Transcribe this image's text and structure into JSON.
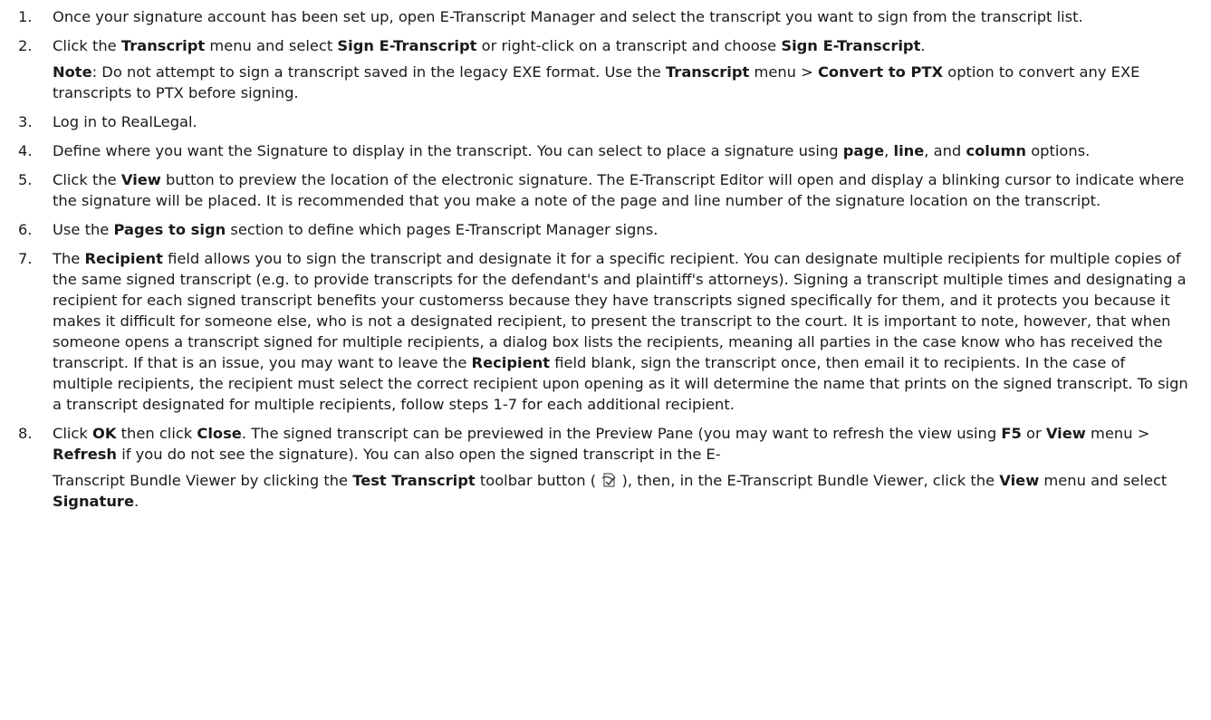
{
  "steps": [
    {
      "num": "1.",
      "parts": [
        {
          "t": "Once your signature account has been set up, open E-Transcript Manager and select the transcript you want to sign from the transcript list."
        }
      ]
    },
    {
      "num": "2.",
      "parts": [
        {
          "t": "Click the "
        },
        {
          "t": "Transcript",
          "b": true
        },
        {
          "t": " menu and select "
        },
        {
          "t": "Sign E-Transcript",
          "b": true
        },
        {
          "t": " or right-click on a transcript and choose "
        },
        {
          "t": "Sign E-Transcript",
          "b": true
        },
        {
          "t": "."
        }
      ],
      "note": [
        {
          "t": "Note",
          "b": true
        },
        {
          "t": ": Do not attempt to sign a transcript saved in the legacy EXE format. Use the "
        },
        {
          "t": "Transcript",
          "b": true
        },
        {
          "t": " menu > "
        },
        {
          "t": "Convert to PTX",
          "b": true
        },
        {
          "t": " option to convert any EXE transcripts to PTX before signing."
        }
      ]
    },
    {
      "num": "3.",
      "parts": [
        {
          "t": "Log in to RealLegal."
        }
      ]
    },
    {
      "num": "4.",
      "parts": [
        {
          "t": "Define where you want the Signature to display in the transcript. You can select to place a signature using "
        },
        {
          "t": "page",
          "b": true
        },
        {
          "t": ", "
        },
        {
          "t": "line",
          "b": true
        },
        {
          "t": ", and "
        },
        {
          "t": "column",
          "b": true
        },
        {
          "t": " options."
        }
      ]
    },
    {
      "num": "5.",
      "parts": [
        {
          "t": "Click the "
        },
        {
          "t": "View",
          "b": true
        },
        {
          "t": " button to preview the location of the electronic signature. The E-Transcript Editor will open and display a blinking cursor to indicate where the signature will be placed. It is recommended that you make a note of the page and line number of the signature location on the transcript."
        }
      ]
    },
    {
      "num": "6.",
      "parts": [
        {
          "t": "Use the "
        },
        {
          "t": "Pages to sign",
          "b": true
        },
        {
          "t": " section to define which pages E-Transcript Manager signs."
        }
      ]
    },
    {
      "num": "7.",
      "parts": [
        {
          "t": "The "
        },
        {
          "t": "Recipient",
          "b": true
        },
        {
          "t": " field allows you to sign the transcript and designate it for a specific recipient. You can designate multiple recipients for multiple copies of the same signed transcript (e.g. to provide transcripts for the defendant's and plaintiff's attorneys). Signing a transcript multiple times and designating a recipient for each signed transcript benefits your customerss because they have transcripts signed specifically for them, and it protects you because it makes it difficult for someone else, who is not a designated recipient, to present the transcript to the court. It is important to note, however, that when someone opens a transcript signed for multiple recipients, a dialog box lists the recipients, meaning all parties in the case know who has received the transcript. If that is an issue, you may want to leave the "
        },
        {
          "t": "Recipient",
          "b": true
        },
        {
          "t": " field blank, sign the transcript once, then email it to recipients. In the case of multiple recipients, the recipient must select the correct recipient upon opening as it will determine the name that prints on the signed transcript. To sign a transcript designated for multiple recipients, follow steps 1-7 for each additional recipient."
        }
      ]
    },
    {
      "num": "8.",
      "parts": [
        {
          "t": "Click "
        },
        {
          "t": "OK",
          "b": true
        },
        {
          "t": " then click "
        },
        {
          "t": "Close",
          "b": true
        },
        {
          "t": ". The signed transcript can be previewed in the Preview Pane (you may want to refresh the view using "
        },
        {
          "t": "F5",
          "b": true
        },
        {
          "t": " or "
        },
        {
          "t": "View",
          "b": true
        },
        {
          "t": " menu > "
        },
        {
          "t": "Refresh",
          "b": true
        },
        {
          "t": " if you do not see the signature). You can also open the signed transcript in the E-"
        }
      ],
      "tail": [
        {
          "t": "Transcript Bundle Viewer by clicking the "
        },
        {
          "t": "Test Transcript",
          "b": true
        },
        {
          "t": " toolbar button ("
        },
        {
          "icon": "test-transcript-icon"
        },
        {
          "t": "), then, in the E-Transcript Bundle Viewer, click the "
        },
        {
          "t": "View",
          "b": true
        },
        {
          "t": " menu and select "
        },
        {
          "t": "Signature",
          "b": true
        },
        {
          "t": "."
        }
      ]
    }
  ]
}
